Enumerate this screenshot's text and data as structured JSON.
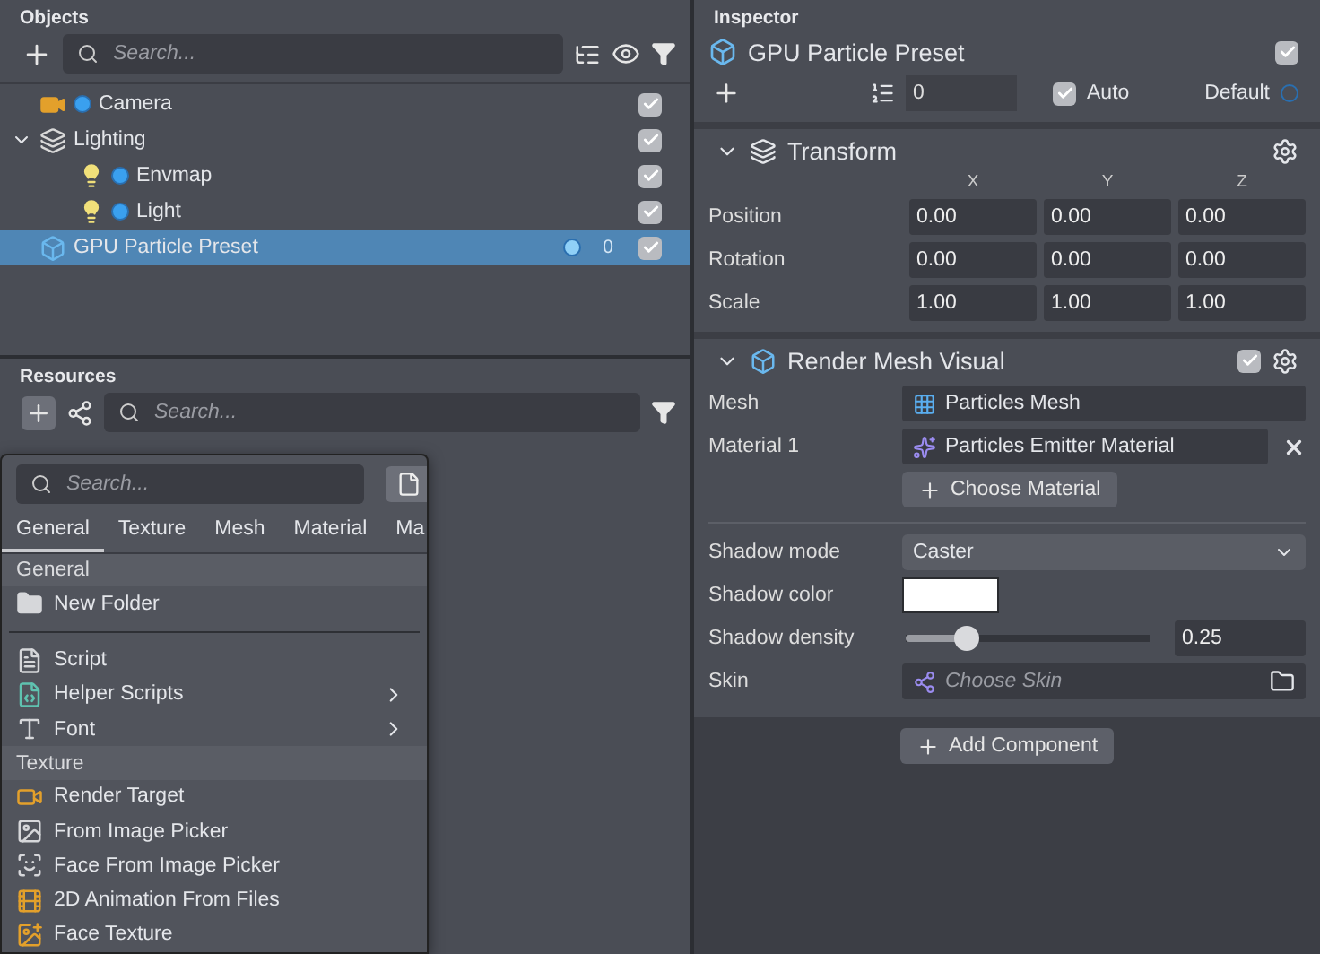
{
  "objects": {
    "title": "Objects",
    "search": {
      "placeholder": "Search..."
    },
    "tree": [
      {
        "name": "Camera",
        "kind": "camera",
        "dot": true,
        "checked": true,
        "selected": false
      },
      {
        "name": "Lighting",
        "kind": "group",
        "dot": false,
        "checked": true,
        "selected": false,
        "expanded": true,
        "children": [
          {
            "name": "Envmap",
            "kind": "light",
            "dot": true,
            "checked": true,
            "selected": false
          },
          {
            "name": "Light",
            "kind": "light",
            "dot": true,
            "checked": true,
            "selected": false
          }
        ]
      },
      {
        "name": "GPU Particle Preset",
        "kind": "mesh",
        "dot": false,
        "checked": true,
        "selected": true,
        "badge": "0"
      }
    ]
  },
  "resources": {
    "title": "Resources",
    "search": {
      "placeholder": "Search..."
    }
  },
  "add_menu": {
    "search": {
      "placeholder": "Search..."
    },
    "tabs": [
      {
        "label": "General",
        "selected": true
      },
      {
        "label": "Texture",
        "selected": false
      },
      {
        "label": "Mesh",
        "selected": false
      },
      {
        "label": "Material",
        "selected": false
      },
      {
        "label": "Ma",
        "selected": false
      }
    ],
    "entries": [
      {
        "kind": "header",
        "label": "General"
      },
      {
        "kind": "item",
        "label": "New Folder",
        "submenu": false
      },
      {
        "kind": "divider"
      },
      {
        "kind": "item",
        "label": "Script",
        "submenu": false
      },
      {
        "kind": "item",
        "label": "Helper Scripts",
        "submenu": true
      },
      {
        "kind": "item",
        "label": "Font",
        "submenu": true
      },
      {
        "kind": "header",
        "label": "Texture"
      },
      {
        "kind": "item",
        "label": "Render Target",
        "submenu": false
      },
      {
        "kind": "item",
        "label": "From Image Picker",
        "submenu": false
      },
      {
        "kind": "item",
        "label": "Face From Image Picker",
        "submenu": false
      },
      {
        "kind": "item",
        "label": "2D Animation From Files",
        "submenu": false
      },
      {
        "kind": "item",
        "label": "Face Texture",
        "submenu": false
      }
    ]
  },
  "inspector": {
    "title": "Inspector",
    "object": {
      "name": "GPU Particle Preset",
      "checked": true
    },
    "layer": "0",
    "auto": {
      "label": "Auto",
      "checked": true
    },
    "render_layer": "Default",
    "transform": {
      "title": "Transform",
      "expanded": true,
      "axes": [
        "X",
        "Y",
        "Z"
      ],
      "rows": [
        {
          "label": "Position",
          "values": [
            "0.00",
            "0.00",
            "0.00"
          ]
        },
        {
          "label": "Rotation",
          "values": [
            "0.00",
            "0.00",
            "0.00"
          ]
        },
        {
          "label": "Scale",
          "values": [
            "1.00",
            "1.00",
            "1.00"
          ]
        }
      ]
    },
    "render_mesh": {
      "title": "Render Mesh Visual",
      "expanded": true,
      "enabled": true,
      "mesh": {
        "label": "Mesh",
        "value": "Particles Mesh"
      },
      "material": {
        "label": "Material 1",
        "value": "Particles Emitter Material"
      },
      "choose_material": "Choose Material",
      "shadow_mode": {
        "label": "Shadow mode",
        "value": "Caster"
      },
      "shadow_color": {
        "label": "Shadow color",
        "color": "#ffffff"
      },
      "shadow_density": {
        "label": "Shadow density",
        "level": 0.25,
        "reading": "0.25"
      },
      "skin": {
        "label": "Skin",
        "placeholder": "Choose Skin"
      }
    },
    "add_component": "Add Component"
  }
}
